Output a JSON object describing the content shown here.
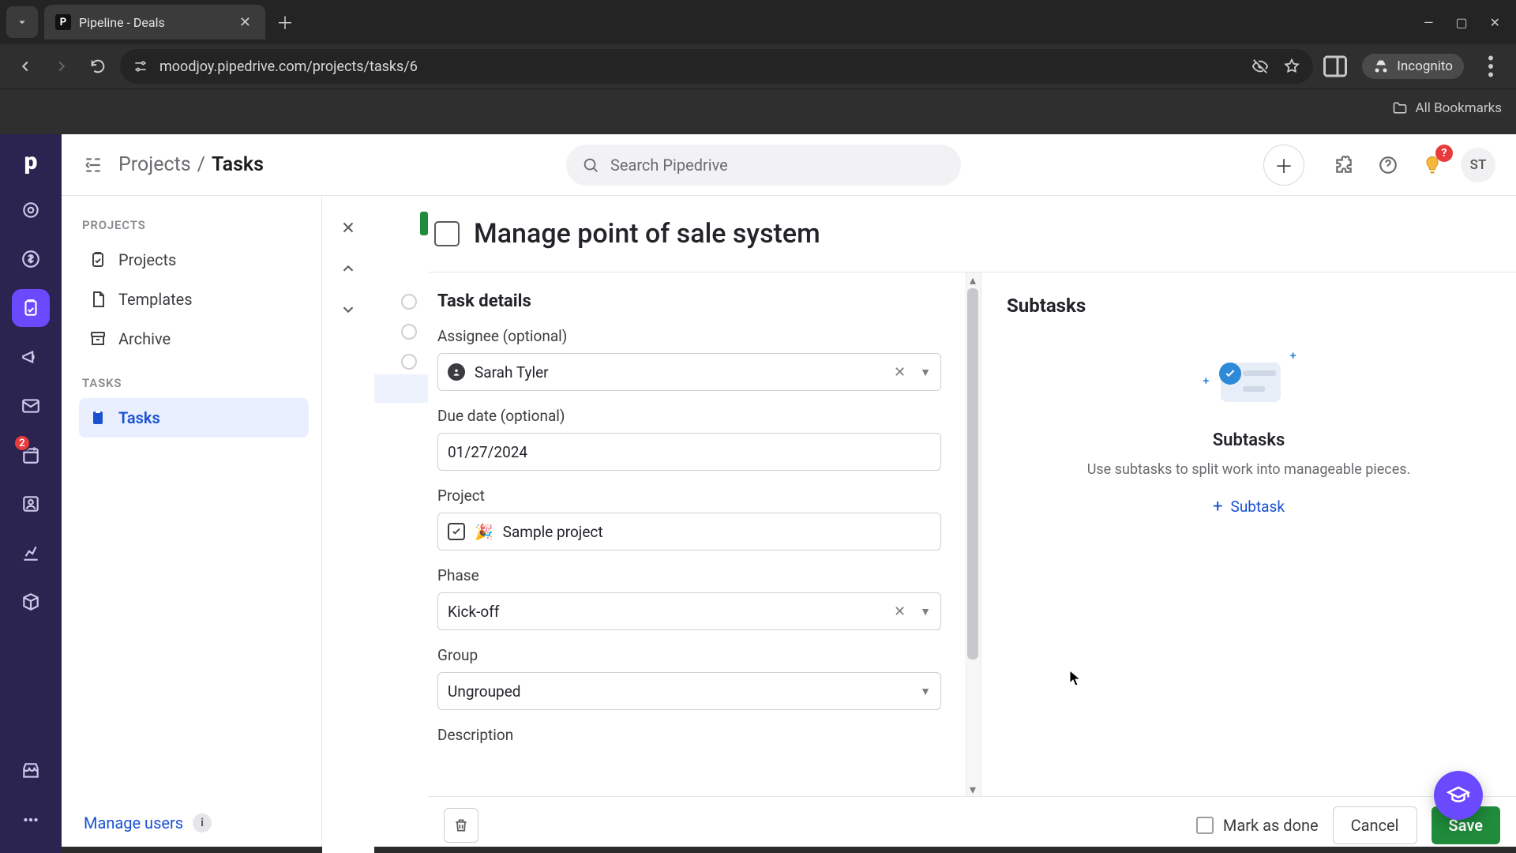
{
  "browser": {
    "tab_title": "Pipeline - Deals",
    "url": "moodjoy.pipedrive.com/projects/tasks/6",
    "incognito_label": "Incognito",
    "all_bookmarks": "All Bookmarks"
  },
  "rail": {
    "calendar_badge": "2"
  },
  "topbar": {
    "breadcrumb_root": "Projects",
    "breadcrumb_sep": "/",
    "breadcrumb_current": "Tasks",
    "search_placeholder": "Search Pipedrive",
    "avatar_initials": "ST"
  },
  "sidebar": {
    "section_projects": "PROJECTS",
    "items_projects": [
      {
        "label": "Projects"
      },
      {
        "label": "Templates"
      },
      {
        "label": "Archive"
      }
    ],
    "section_tasks": "TASKS",
    "items_tasks": [
      {
        "label": "Tasks"
      }
    ],
    "manage_users": "Manage users"
  },
  "task": {
    "title": "Manage point of sale system",
    "details_heading": "Task details",
    "fields": {
      "assignee_label": "Assignee (optional)",
      "assignee_value": "Sarah Tyler",
      "due_label": "Due date (optional)",
      "due_value": "01/27/2024",
      "project_label": "Project",
      "project_value": "Sample project",
      "project_emoji": "🎉",
      "phase_label": "Phase",
      "phase_value": "Kick-off",
      "group_label": "Group",
      "group_value": "Ungrouped",
      "description_label": "Description"
    },
    "subtasks": {
      "heading": "Subtasks",
      "empty_title": "Subtasks",
      "empty_desc": "Use subtasks to split work into manageable pieces.",
      "add_label": "Subtask"
    },
    "footer": {
      "mark_done": "Mark as done",
      "cancel": "Cancel",
      "save": "Save"
    }
  }
}
